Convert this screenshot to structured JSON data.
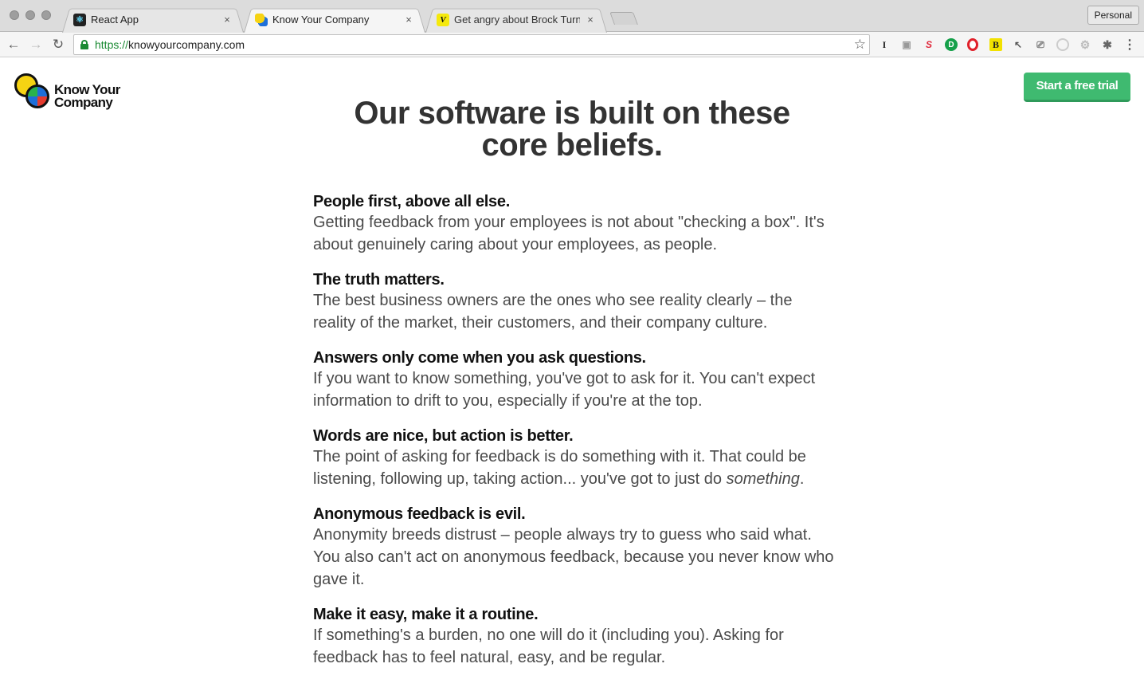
{
  "browser": {
    "tabs": [
      {
        "title": "React App",
        "favicon": "react-icon",
        "active": false
      },
      {
        "title": "Know Your Company",
        "favicon": "kyc-icon",
        "active": true
      },
      {
        "title": "Get angry about Brock Turner'",
        "favicon": "vox-icon",
        "active": false
      }
    ],
    "close_glyph": "×",
    "profile": "Personal",
    "url_scheme": "https://",
    "url_host": "knowyourcompany.com",
    "extensions": [
      "instapaper-icon",
      "camera-icon",
      "stumbleupon-icon",
      "grammarly-icon",
      "opera-icon",
      "bookmarklet-b-icon",
      "picker-icon",
      "cast-icon",
      "circle-icon",
      "gear-icon",
      "bug-icon",
      "menu-icon"
    ],
    "accent_colors": {
      "secure": "#1a8a33"
    }
  },
  "page": {
    "logo_line1": "Know Your",
    "logo_line2": "Company",
    "cta_label": "Start a free trial",
    "cta_color": "#3fba70",
    "headline_line1": "Our software is built on these",
    "headline_line2": "core beliefs.",
    "beliefs": [
      {
        "title": "People first, above all else.",
        "body": "Getting feedback from your employees is not about \"checking a box\". It's about genuinely caring about your employees, as people."
      },
      {
        "title": "The truth matters.",
        "body": "The best business owners are the ones who see reality clearly – the reality of the market, their customers, and their company culture."
      },
      {
        "title": "Answers only come when you ask questions.",
        "body": "If you want to know something, you've got to ask for it. You can't expect information to drift to you, especially if you're at the top."
      },
      {
        "title": "Words are nice, but action is better.",
        "body": "The point of asking for feedback is do something with it. That could be listening, following up, taking action... you've got to just do ",
        "body_em": "something",
        "body_end": "."
      },
      {
        "title": "Anonymous feedback is evil.",
        "body": "Anonymity breeds distrust – people always try to guess who said what. You also can't act on anonymous feedback, because you never know who gave it."
      },
      {
        "title": "Make it easy, make it a routine.",
        "body": "If something's a burden, no one will do it (including you). Asking for feedback has to feel natural, easy, and be regular."
      }
    ]
  }
}
